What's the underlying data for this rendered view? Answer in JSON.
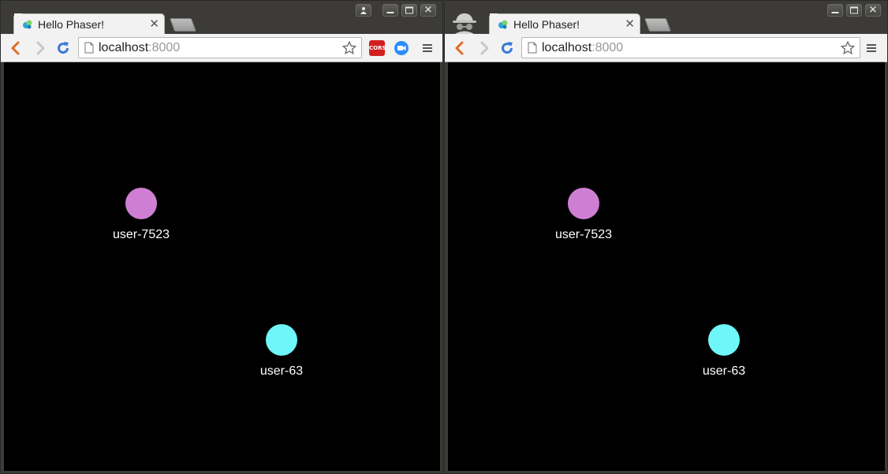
{
  "windows": [
    {
      "incognito": false,
      "tab_title": "Hello Phaser!",
      "url_host": "localhost",
      "url_port": ":8000",
      "extensions": [
        {
          "icon": "cors-extension-icon",
          "label": "CORS",
          "color": "#d21f1f"
        },
        {
          "icon": "video-call-extension-icon",
          "color": "#2d8cff"
        }
      ]
    },
    {
      "incognito": true,
      "tab_title": "Hello Phaser!",
      "url_host": "localhost",
      "url_port": ":8000"
    }
  ],
  "players": [
    {
      "name": "user-7523",
      "color": "#cf7fd3"
    },
    {
      "name": "user-63",
      "color": "#6ef6f8"
    }
  ],
  "colors": {
    "canvas_background": "#000000",
    "reload_icon": "#3a78d8",
    "back_icon": "#e06a2c"
  }
}
